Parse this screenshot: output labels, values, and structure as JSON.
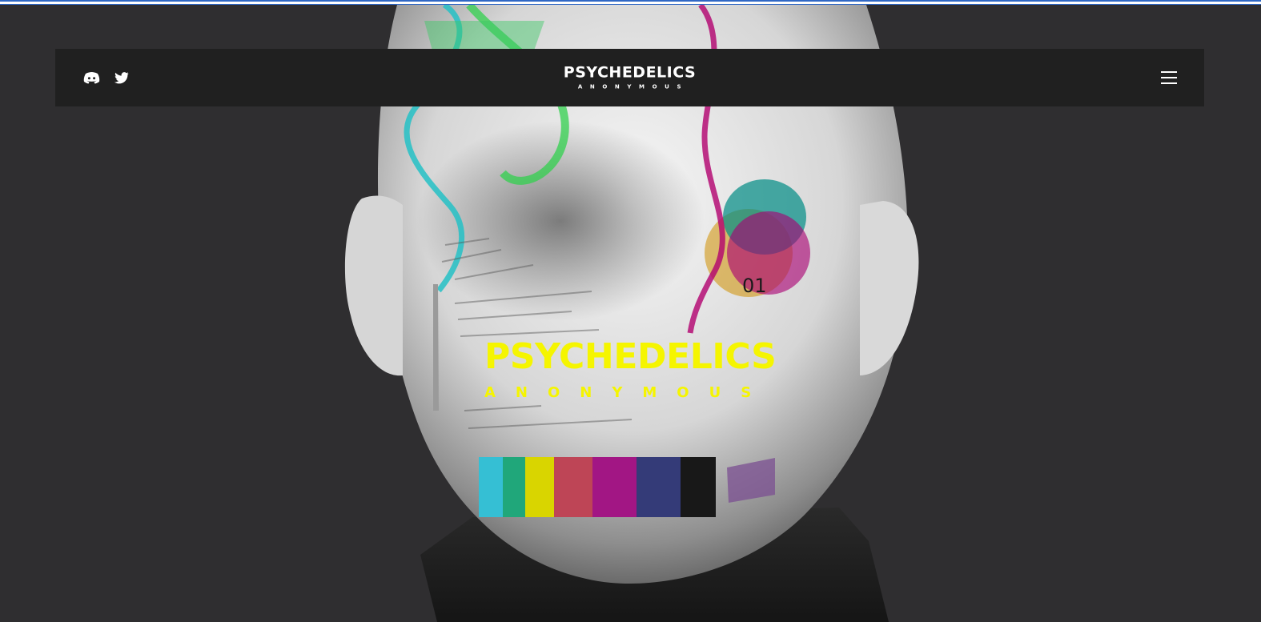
{
  "brand": {
    "logo_main": "PSYCHEDELICS",
    "logo_sub": "ANONYMOUS"
  },
  "header": {
    "social_icons": [
      "discord-icon",
      "twitter-icon"
    ],
    "menu_icon": "hamburger-menu-icon"
  },
  "hero": {
    "title": "PSYCHEDELICS",
    "subtitle": "ANONYMOUS",
    "overlay_number": "01",
    "colors": {
      "title": "#f5f500",
      "background": "#2f2e30",
      "navbar": "#202020"
    }
  }
}
